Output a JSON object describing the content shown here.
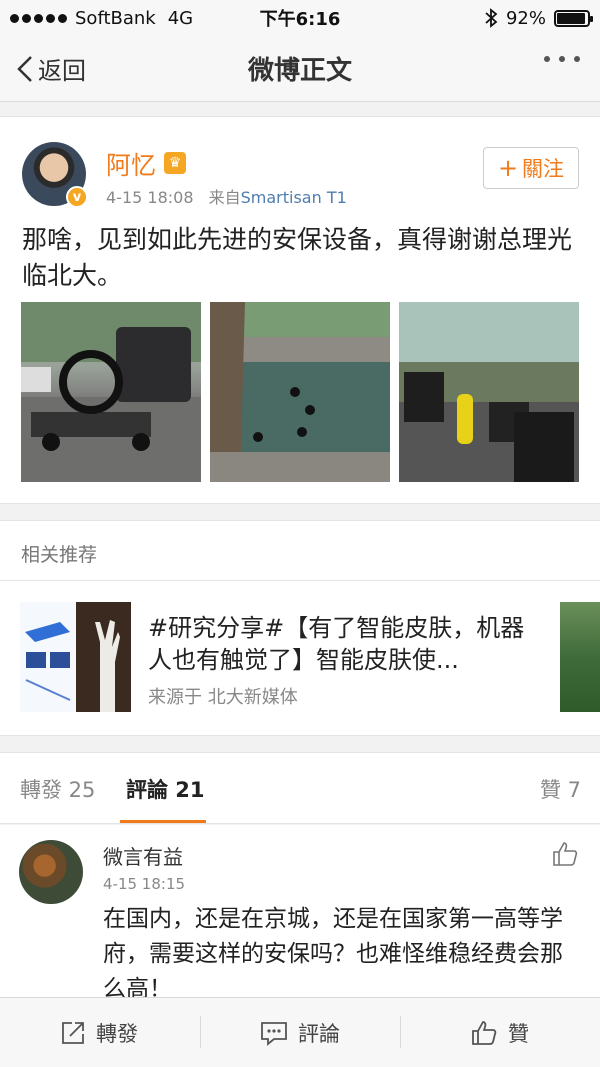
{
  "status_bar": {
    "carrier": "SoftBank",
    "network": "4G",
    "time": "下午6:16",
    "battery": "92%",
    "battery_level": 0.92
  },
  "nav": {
    "back_label": "返回",
    "title": "微博正文"
  },
  "post": {
    "author": "阿忆",
    "date": "4-15 18:08",
    "source_prefix": "来自",
    "source": "Smartisan T1",
    "follow_label": "關注",
    "text": "那啥，见到如此先进的安保设备，真得谢谢总理光临北大。",
    "photos": [
      "photo-1",
      "photo-2",
      "photo-3"
    ]
  },
  "recommend": {
    "header": "相关推荐",
    "title": "#研究分享#【有了智能皮肤，机器人也有触觉了】智能皮肤使...",
    "source": "来源于 北大新媒体"
  },
  "tabs": {
    "repost_label": "轉發 25",
    "comments_label": "評論 21",
    "likes_label": "贊 7"
  },
  "comment": {
    "author": "微言有益",
    "date": "4-15 18:15",
    "text": "在国内，还是在京城，还是在国家第一高等学府，需要这样的安保吗？也难怪维稳经费会那么高！"
  },
  "toolbar": {
    "repost": "轉發",
    "comment": "評論",
    "like": "贊"
  }
}
